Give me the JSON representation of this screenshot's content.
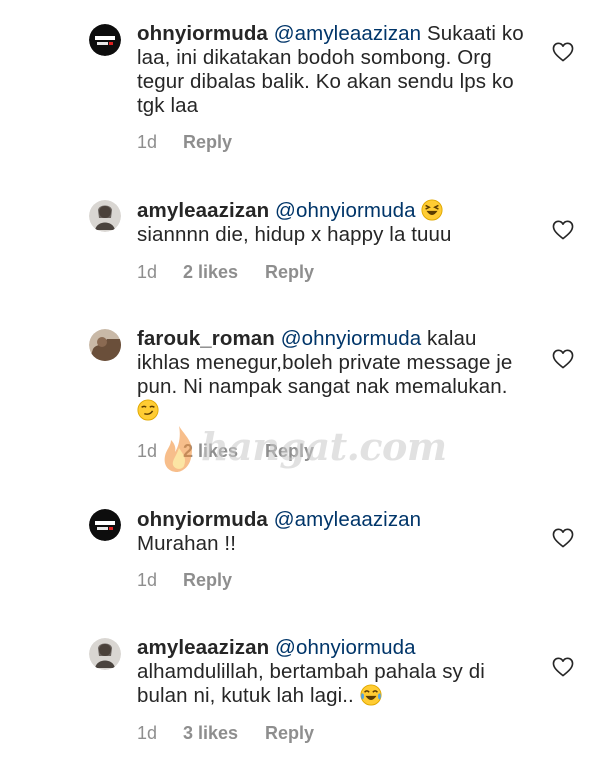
{
  "comments": [
    {
      "username": "ohnyiormuda",
      "mention": "@amyleaazizan",
      "text": "Sukaati ko laa, ini dikatakan bodoh sombong. Org tegur dibalas balik. Ko akan sendu lps ko tgk laa",
      "time": "1d",
      "likes": "",
      "reply": "Reply",
      "avatar_icon": "ohnyiormuda-logo-avatar"
    },
    {
      "username": "amyleaazizan",
      "mention": "@ohnyiormuda",
      "text": "siannnn die, hidup x happy la tuuu",
      "emoji": "squinting-laughing-emoji",
      "time": "1d",
      "likes": "2 likes",
      "reply": "Reply",
      "avatar_icon": "user-photo-avatar"
    },
    {
      "username": "farouk_roman",
      "mention": "@ohnyiormuda",
      "text": "kalau ikhlas menegur,boleh private message je pun. Ni nampak sangat nak memalukan.",
      "emoji": "smirking-emoji",
      "time": "1d",
      "likes": "2 likes",
      "reply": "Reply",
      "avatar_icon": "user-photo-avatar"
    },
    {
      "username": "ohnyiormuda",
      "mention": "@amyleaazizan",
      "text": "Murahan !!",
      "time": "1d",
      "likes": "",
      "reply": "Reply",
      "avatar_icon": "ohnyiormuda-logo-avatar"
    },
    {
      "username": "amyleaazizan",
      "mention": "@ohnyiormuda",
      "text": "alhamdulillah, bertambah pahala sy di bulan ni, kutuk lah lagi..",
      "emoji": "tears-of-joy-emoji",
      "time": "1d",
      "likes": "3 likes",
      "reply": "Reply",
      "avatar_icon": "user-photo-avatar"
    }
  ],
  "watermark": "hangat.com",
  "colors": {
    "text": "#262626",
    "mention": "#003569",
    "meta": "#8e8e8e"
  },
  "icons": {
    "like": "heart-outline-icon",
    "watermark_flame": "flame-icon"
  }
}
